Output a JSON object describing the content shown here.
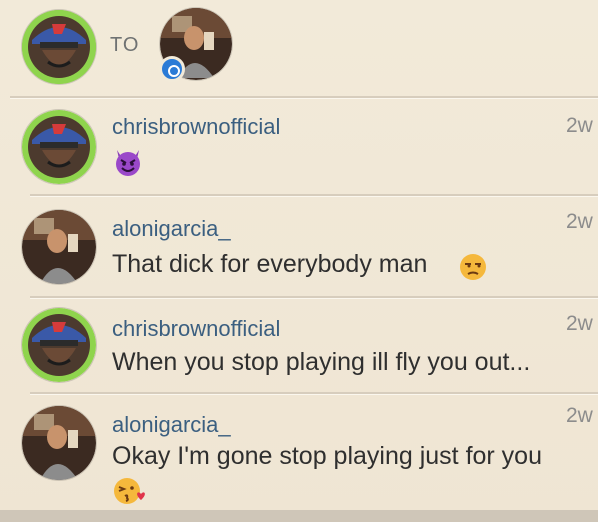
{
  "header": {
    "to_label": "TO"
  },
  "comments": [
    {
      "username": "chrisbrownofficial",
      "time": "2w",
      "text": "",
      "emoji": "devil-emoji"
    },
    {
      "username": "alonigarcia_",
      "time": "2w",
      "text": "That dick for everybody man",
      "emoji": "unamused-face-emoji"
    },
    {
      "username": "chrisbrownofficial",
      "time": "2w",
      "text": "When you stop playing ill fly you out...",
      "emoji": ""
    },
    {
      "username": "alonigarcia_",
      "time": "2w",
      "text": "Okay I'm gone stop playing just for you",
      "emoji": "kissing-face-emoji"
    }
  ],
  "colors": {
    "background": "#efe6d6",
    "username": "#3b5f80",
    "message": "#2f2f2f",
    "time": "#8c8c8c",
    "badge": "#2b7bd6"
  }
}
